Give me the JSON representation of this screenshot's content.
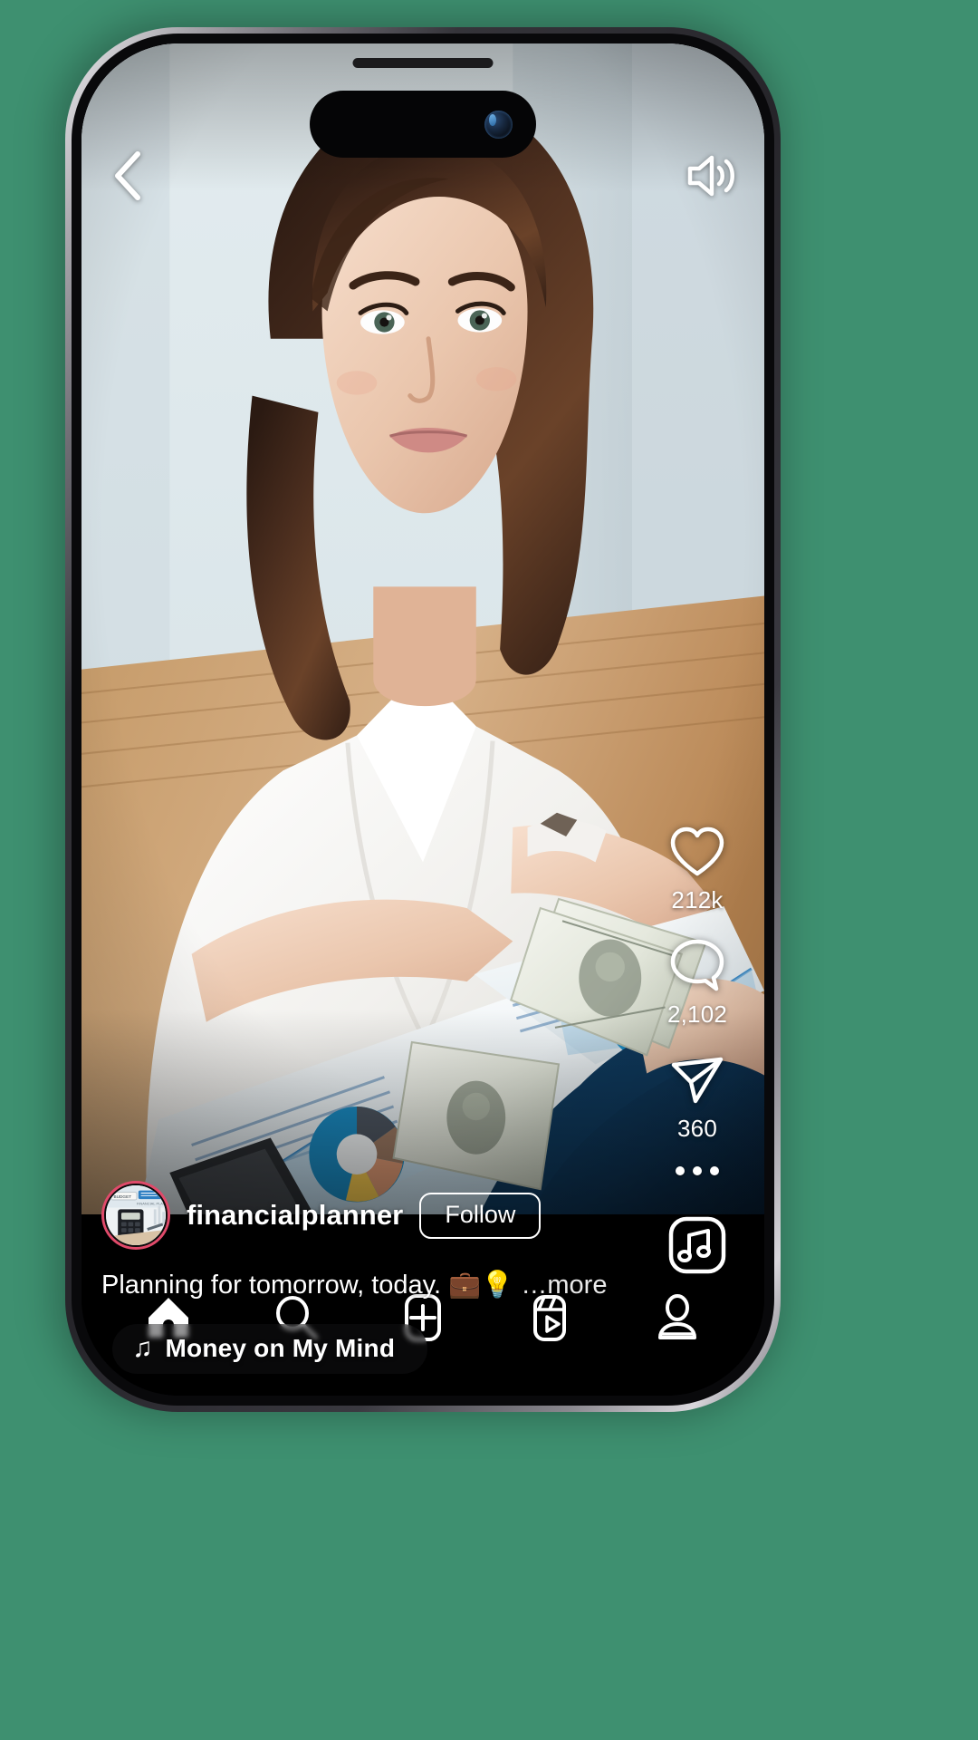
{
  "app": {
    "name": "instagram-reels-viewer",
    "device": "smartphone-mockup"
  },
  "colors": {
    "background": "#3e9070",
    "avatar_ring": "#e04a6a",
    "overlay_text": "#ffffff",
    "navbar": "#000000",
    "music_pill": "rgba(20,20,22,0.46)"
  },
  "top_bar": {
    "back_icon": "chevron-left-icon",
    "sound_icon": "speaker-on-icon"
  },
  "actions": [
    {
      "icon": "heart-icon",
      "name": "like",
      "count": "212k"
    },
    {
      "icon": "comment-icon",
      "name": "comment",
      "count": "2,102"
    },
    {
      "icon": "share-icon",
      "name": "share",
      "count": "360"
    },
    {
      "icon": "more-options-icon",
      "name": "more",
      "count": ""
    }
  ],
  "post": {
    "username": "financialplanner",
    "follow_label": "Follow",
    "caption": "Planning for tomorrow, today. 💼💡",
    "caption_more": "…more",
    "avatar_alt": "calculator-financial-plan-thumbnail"
  },
  "audio": {
    "note_icon": "music-note-icon",
    "title": "Money on My Mind",
    "disc_icon": "audio-album-icon"
  },
  "navbar": [
    {
      "name": "home",
      "icon": "home-icon",
      "active": true
    },
    {
      "name": "search",
      "icon": "search-icon",
      "active": false
    },
    {
      "name": "create",
      "icon": "plus-square-icon",
      "active": false
    },
    {
      "name": "reels",
      "icon": "reels-icon",
      "active": false
    },
    {
      "name": "profile",
      "icon": "profile-icon",
      "active": false
    }
  ]
}
